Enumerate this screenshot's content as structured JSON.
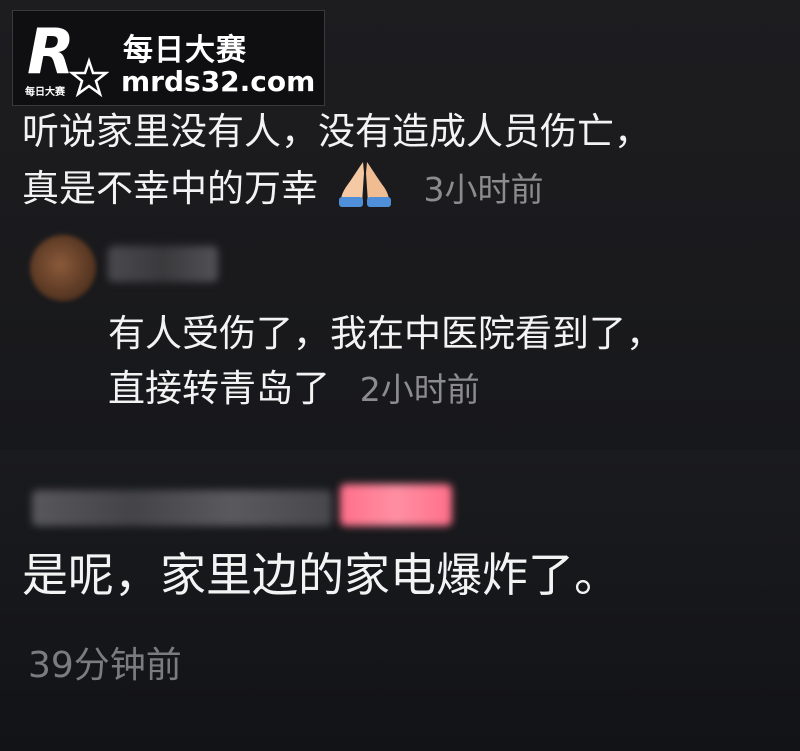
{
  "watermark": {
    "title": "每日大赛",
    "url": "mrds32.com",
    "logo_letter": "R",
    "logo_caption": "每日大赛"
  },
  "comments": [
    {
      "line1": "听说家里没有人，没有造成人员伤亡，",
      "line2": "真是不幸中的万幸",
      "emoji": "folded-hands-emoji",
      "time": "3小时前"
    },
    {
      "line1": "有人受伤了，我在中医院看到了，",
      "line2": "直接转青岛了",
      "time": "2小时前"
    },
    {
      "line1": "是呢，家里边的家电爆炸了。",
      "time": "39分钟前"
    }
  ],
  "colors": {
    "background": "#111214",
    "text": "#f3f3f3",
    "timestamp": "#8c8c8f",
    "badge": "#ff7f96"
  }
}
